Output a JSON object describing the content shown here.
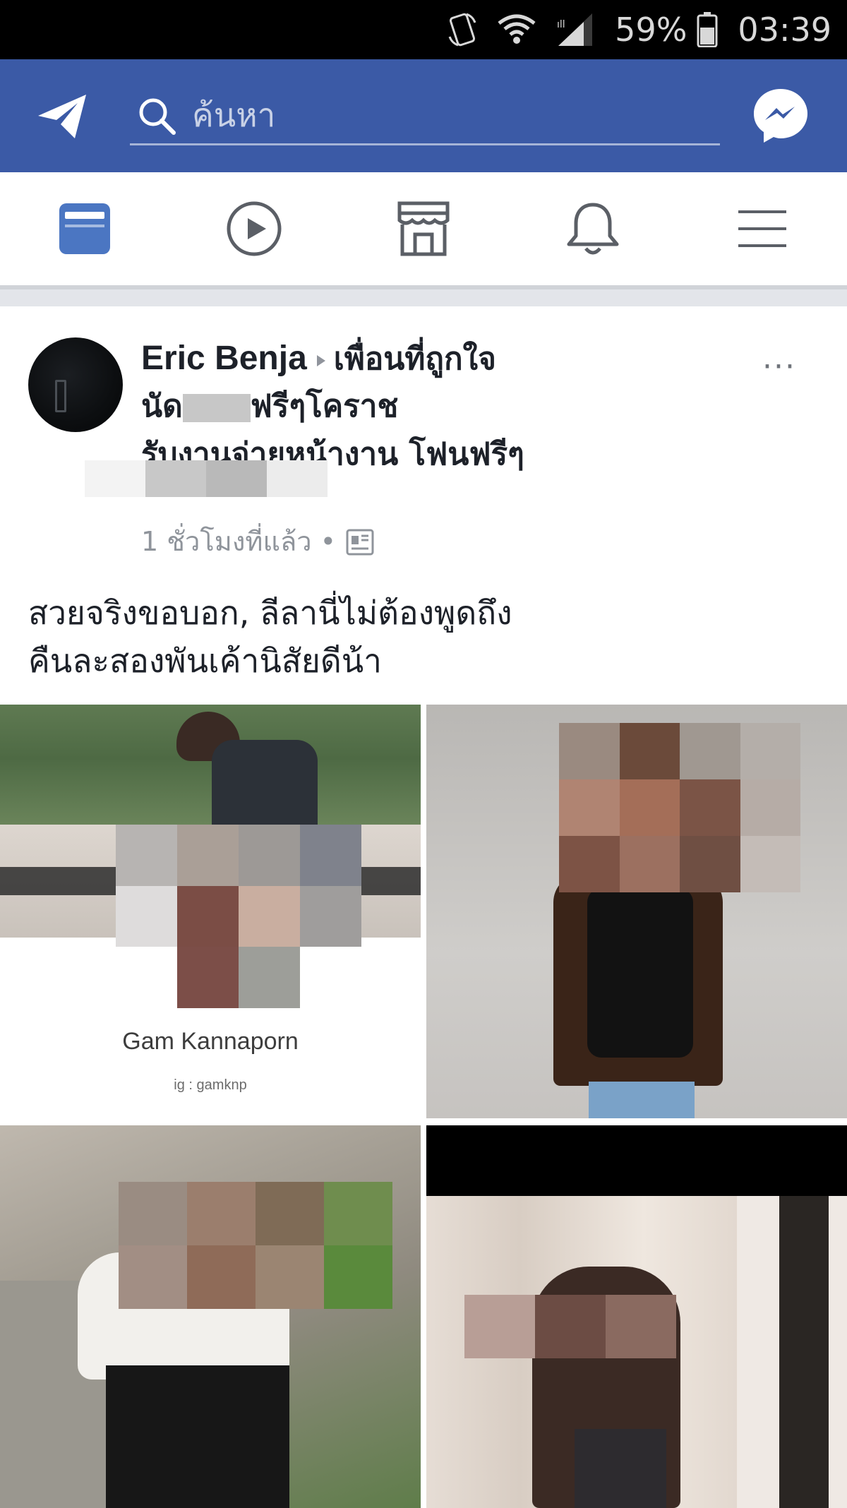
{
  "status_bar": {
    "battery": "59%",
    "time": "03:39",
    "icons": [
      "rotate-icon",
      "wifi-icon",
      "signal-icon",
      "battery-icon"
    ]
  },
  "app_bar": {
    "search_placeholder": "ค้นหา",
    "background_color": "#3b5aa6",
    "icons": [
      "send-icon",
      "search-icon",
      "messenger-icon"
    ]
  },
  "tabs": [
    {
      "name": "news-feed-tab",
      "icon": "news-feed-icon",
      "active": true
    },
    {
      "name": "video-tab",
      "icon": "video-icon",
      "active": false
    },
    {
      "name": "marketplace-tab",
      "icon": "marketplace-icon",
      "active": false
    },
    {
      "name": "notifications-tab",
      "icon": "bell-icon",
      "active": false
    },
    {
      "name": "menu-tab",
      "icon": "menu-icon",
      "active": false
    }
  ],
  "post": {
    "author": "Eric Benja",
    "group_line1": "เพื่อนที่ถูกใจ",
    "group_line2_prefix": "นัด",
    "group_line2_suffix": "ฟรีๆโคราช",
    "group_line3": "รับงานจ่ายหน้างาน  โฟนฟรีๆ",
    "timestamp": "1 ชั่วโมงที่แล้ว",
    "separator": "•",
    "text_line1": "สวยจริงขอบอก, ลีลานี่ไม่ต้องพูดถึง",
    "text_line2": "คืนละสองพันเค้านิสัยดีน้า",
    "photos": [
      {
        "caption_name": "Gam Kannaporn",
        "caption_sub": "ig : gamknp"
      },
      {},
      {},
      {}
    ]
  }
}
